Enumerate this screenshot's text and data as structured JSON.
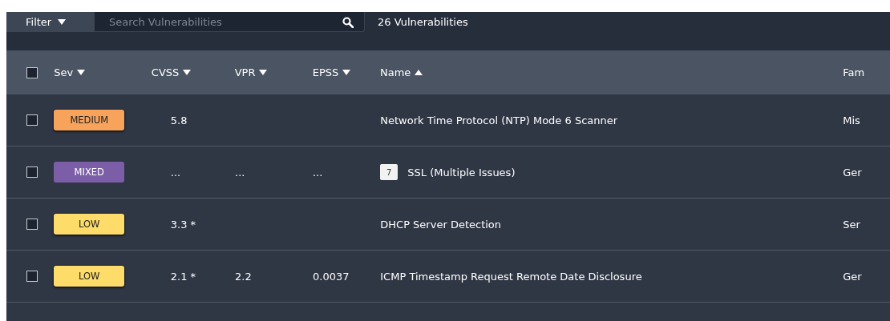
{
  "toolbar": {
    "filter_label": "Filter",
    "search": {
      "placeholder": "Search Vulnerabilities"
    },
    "count": "26 Vulnerabilities"
  },
  "table": {
    "select_all": {
      "checked": false
    },
    "columns": [
      {
        "label": "Sev",
        "kind": "desc"
      },
      {
        "label": "CVSS",
        "kind": "desc"
      },
      {
        "label": "VPR",
        "kind": "desc"
      },
      {
        "label": "EPSS",
        "kind": "desc"
      },
      {
        "label": "Name",
        "kind": "asc"
      },
      {
        "label": "Fam",
        "kind": "plain"
      }
    ],
    "rows": [
      {
        "checked": false,
        "severity": "MEDIUM",
        "kind": "medium",
        "cvss": "5.8",
        "name": "Network Time Protocol (NTP) Mode 6 Scanner",
        "family": "Mis"
      },
      {
        "checked": false,
        "severity": "MIXED",
        "kind": "mixed",
        "cvss": "...",
        "vpr": "...",
        "epss": "...",
        "group_count": "7",
        "name": "SSL (Multiple Issues)",
        "family": "Ger"
      },
      {
        "checked": false,
        "severity": "LOW",
        "kind": "low",
        "cvss": "3.3 *",
        "name": "DHCP Server Detection",
        "family": "Ser"
      },
      {
        "checked": false,
        "severity": "LOW",
        "kind": "low",
        "cvss": "2.1 *",
        "vpr": "2.2",
        "epss": "0.0037",
        "name": "ICMP Timestamp Request Remote Date Disclosure",
        "family": "Ger"
      }
    ]
  }
}
